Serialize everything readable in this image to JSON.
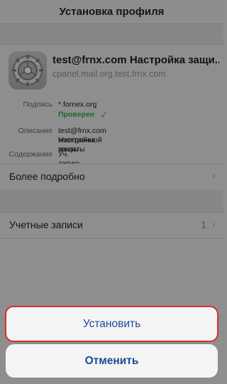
{
  "nav": {
    "title": "Установка профиля"
  },
  "profile": {
    "name": "test@frnx.com Настройка защи...",
    "host": "cpanel.mail.org.test.frnx.com",
    "signature_label": "Подпись",
    "signature_value": "*.fornex.org",
    "verified_text": "Проверен",
    "description_label": "Описание",
    "description_line1": "test@frnx.com Настройка защиты",
    "description_line2": "электронной почты",
    "contents_label": "Содержание",
    "contents_value": "Уч. запись e-mail"
  },
  "more_details": {
    "label": "Более подробно"
  },
  "accounts": {
    "label": "Учетные записи",
    "count": "1"
  },
  "actions": {
    "install_label": "Установить",
    "cancel_label": "Отменить"
  },
  "icons": {
    "app_icon": "settings-gear-icon",
    "verified_icon": "checkmark-icon",
    "chevron": "chevron-right-icon"
  },
  "colors": {
    "action_text": "#1c4a93",
    "verified": "#1b6b26",
    "highlight_border": "#d92e2e"
  }
}
